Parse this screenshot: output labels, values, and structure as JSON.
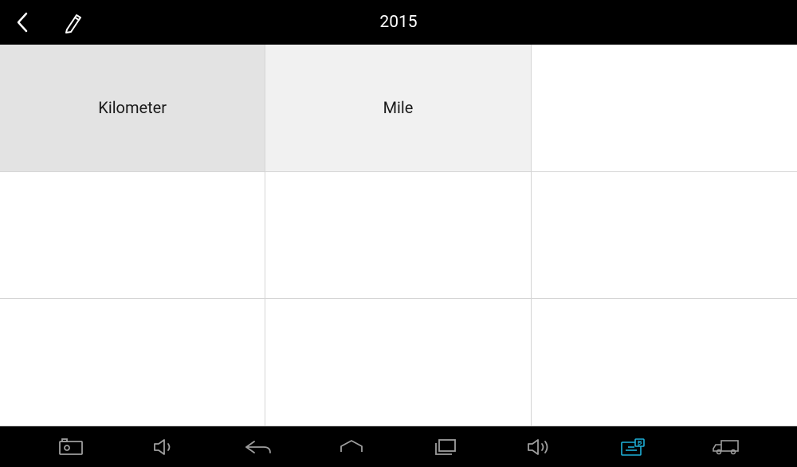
{
  "header": {
    "title": "2015"
  },
  "grid": {
    "cells": [
      {
        "label": "Kilometer"
      },
      {
        "label": "Mile"
      },
      {
        "label": ""
      },
      {
        "label": ""
      },
      {
        "label": ""
      },
      {
        "label": ""
      },
      {
        "label": ""
      },
      {
        "label": ""
      },
      {
        "label": ""
      }
    ]
  }
}
